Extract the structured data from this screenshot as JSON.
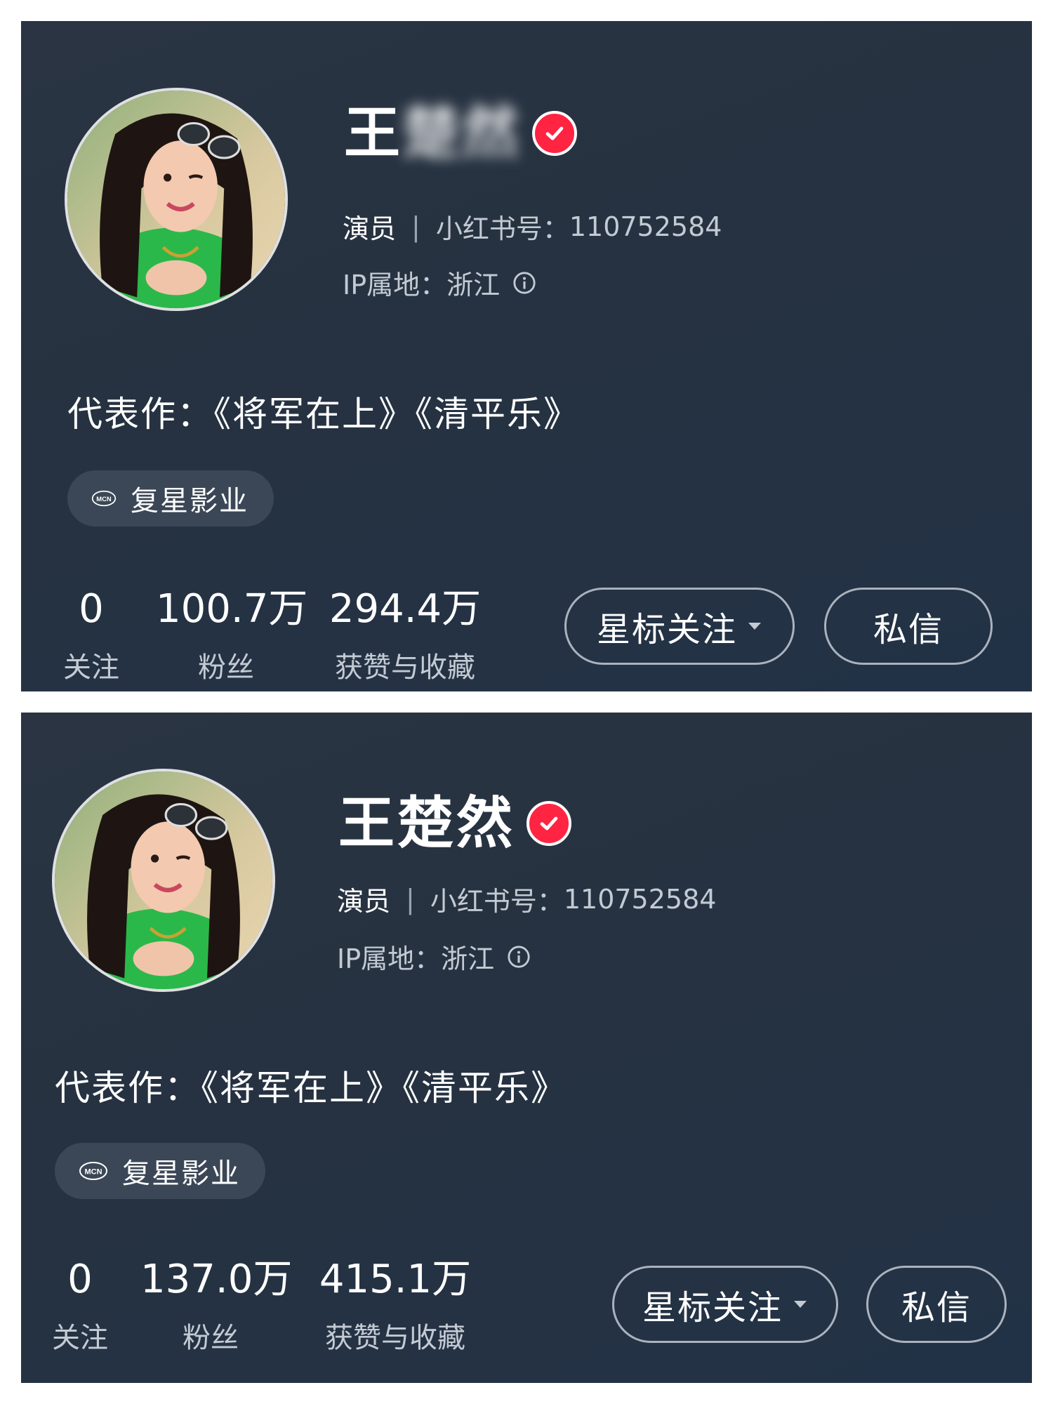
{
  "panels": [
    {
      "name_visible": "王",
      "name_blurred": "楚然",
      "role": "演员",
      "id_label": "小红书号：",
      "id_value": "110752584",
      "ip_label": "IP属地：",
      "ip_value": "浙江",
      "works_label": "代表作：",
      "works": "《将军在上》《清平乐》",
      "mcn_badge": "MCN",
      "mcn_name": "复星影业",
      "stats": [
        {
          "value": "0",
          "label": "关注"
        },
        {
          "value": "100.7万",
          "label": "粉丝"
        },
        {
          "value": "294.4万",
          "label": "获赞与收藏"
        }
      ],
      "star_follow_label": "星标关注",
      "message_label": "私信"
    },
    {
      "name": "王楚然",
      "role": "演员",
      "id_label": "小红书号：",
      "id_value": "110752584",
      "ip_label": "IP属地：",
      "ip_value": "浙江",
      "works_label": "代表作：",
      "works": "《将军在上》《清平乐》",
      "mcn_badge": "MCN",
      "mcn_name": "复星影业",
      "stats": [
        {
          "value": "0",
          "label": "关注"
        },
        {
          "value": "137.0万",
          "label": "粉丝"
        },
        {
          "value": "415.1万",
          "label": "获赞与收藏"
        }
      ],
      "star_follow_label": "星标关注",
      "message_label": "私信"
    }
  ],
  "icons": {
    "verified": "verified-check-icon",
    "info": "info-circle-icon",
    "mcn": "mcn-icon",
    "caret": "caret-down-icon"
  },
  "colors": {
    "background": "#263241",
    "verified": "#ff2442",
    "tag": "#3b4756",
    "muted_text": "#c3cad3"
  }
}
